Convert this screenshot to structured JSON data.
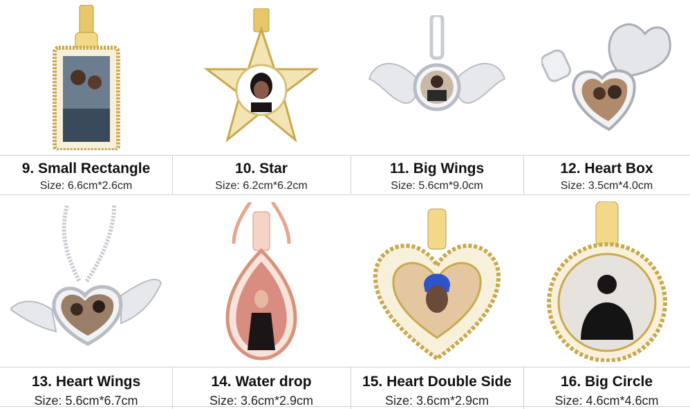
{
  "colors": {
    "gold": "#e8c76a",
    "silver": "#d9dde3",
    "rose": "#e8a58c",
    "border": "#cfcfcf"
  },
  "items": [
    {
      "name": "9. Small Rectangle",
      "size": "Size: 6.6cm*2.6cm",
      "metal": "gold"
    },
    {
      "name": "10. Star",
      "size": "Size: 6.2cm*6.2cm",
      "metal": "gold"
    },
    {
      "name": "11. Big Wings",
      "size": "Size: 5.6cm*9.0cm",
      "metal": "silver"
    },
    {
      "name": "12. Heart Box",
      "size": "Size: 3.5cm*4.0cm",
      "metal": "silver"
    },
    {
      "name": "13. Heart Wings",
      "size": "Size: 5.6cm*6.7cm",
      "metal": "silver"
    },
    {
      "name": "14. Water drop",
      "size": "Size: 3.6cm*2.9cm",
      "metal": "rose"
    },
    {
      "name": "15. Heart Double Side",
      "size": "Size: 3.6cm*2.9cm",
      "metal": "gold"
    },
    {
      "name": "16. Big Circle",
      "size": "Size: 4.6cm*4.6cm",
      "metal": "gold"
    }
  ]
}
